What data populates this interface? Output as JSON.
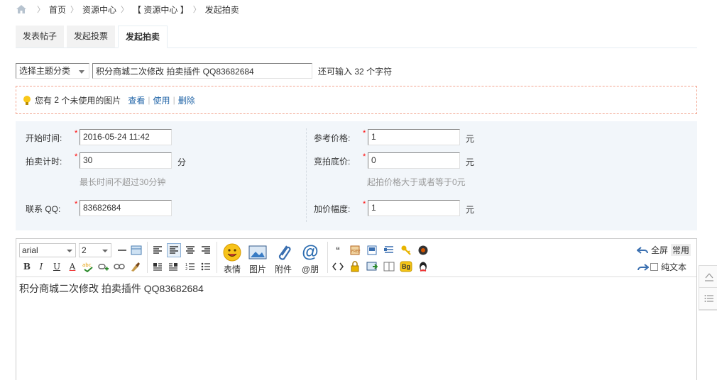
{
  "breadcrumb": [
    "首页",
    "资源中心",
    "【 资源中心 】",
    "发起拍卖"
  ],
  "tabs": [
    {
      "label": "发表帖子",
      "active": false
    },
    {
      "label": "发起投票",
      "active": false
    },
    {
      "label": "发起拍卖",
      "active": true
    }
  ],
  "subject": {
    "category": "选择主题分类",
    "title_value": "积分商城二次修改 拍卖插件 QQ83682684",
    "remaining_pre": "还可输入",
    "remaining_count": "32",
    "remaining_post": "个字符"
  },
  "notice": {
    "text_pre": "您有",
    "count": "2",
    "text_post": "个未使用的图片",
    "view": "查看",
    "use": "使用",
    "delete": "删除"
  },
  "form": {
    "start_time_label": "开始时间:",
    "start_time_value": "2016-05-24 11:42",
    "duration_label": "拍卖计时:",
    "duration_value": "30",
    "duration_unit": "分",
    "duration_hint": "最长时间不超过30分钟",
    "qq_label": "联系 QQ:",
    "qq_value": "83682684",
    "ref_price_label": "参考价格:",
    "ref_price_value": "1",
    "ref_price_unit": "元",
    "reserve_label": "竞拍底价:",
    "reserve_value": "0",
    "reserve_unit": "元",
    "reserve_hint": "起拍价格大于或者等于0元",
    "increment_label": "加价幅度:",
    "increment_value": "1",
    "increment_unit": "元",
    "required_mark": "*"
  },
  "editor": {
    "font": "arial",
    "size": "2",
    "emoji_label": "表情",
    "image_label": "图片",
    "attach_label": "附件",
    "at_label": "@朋",
    "fullscreen_label": "全屏",
    "common_label": "常用",
    "plaintext_label": "纯文本",
    "bold": "B",
    "italic": "I",
    "underline": "U",
    "fontcolor": "A",
    "content": "积分商城二次修改 拍卖插件 QQ83682684",
    "bg_label": "Bg"
  },
  "colors": {
    "link": "#2366a8",
    "required": "#ff0000",
    "form_bg": "#f2f6fa",
    "notice_border": "#f2a48f"
  }
}
